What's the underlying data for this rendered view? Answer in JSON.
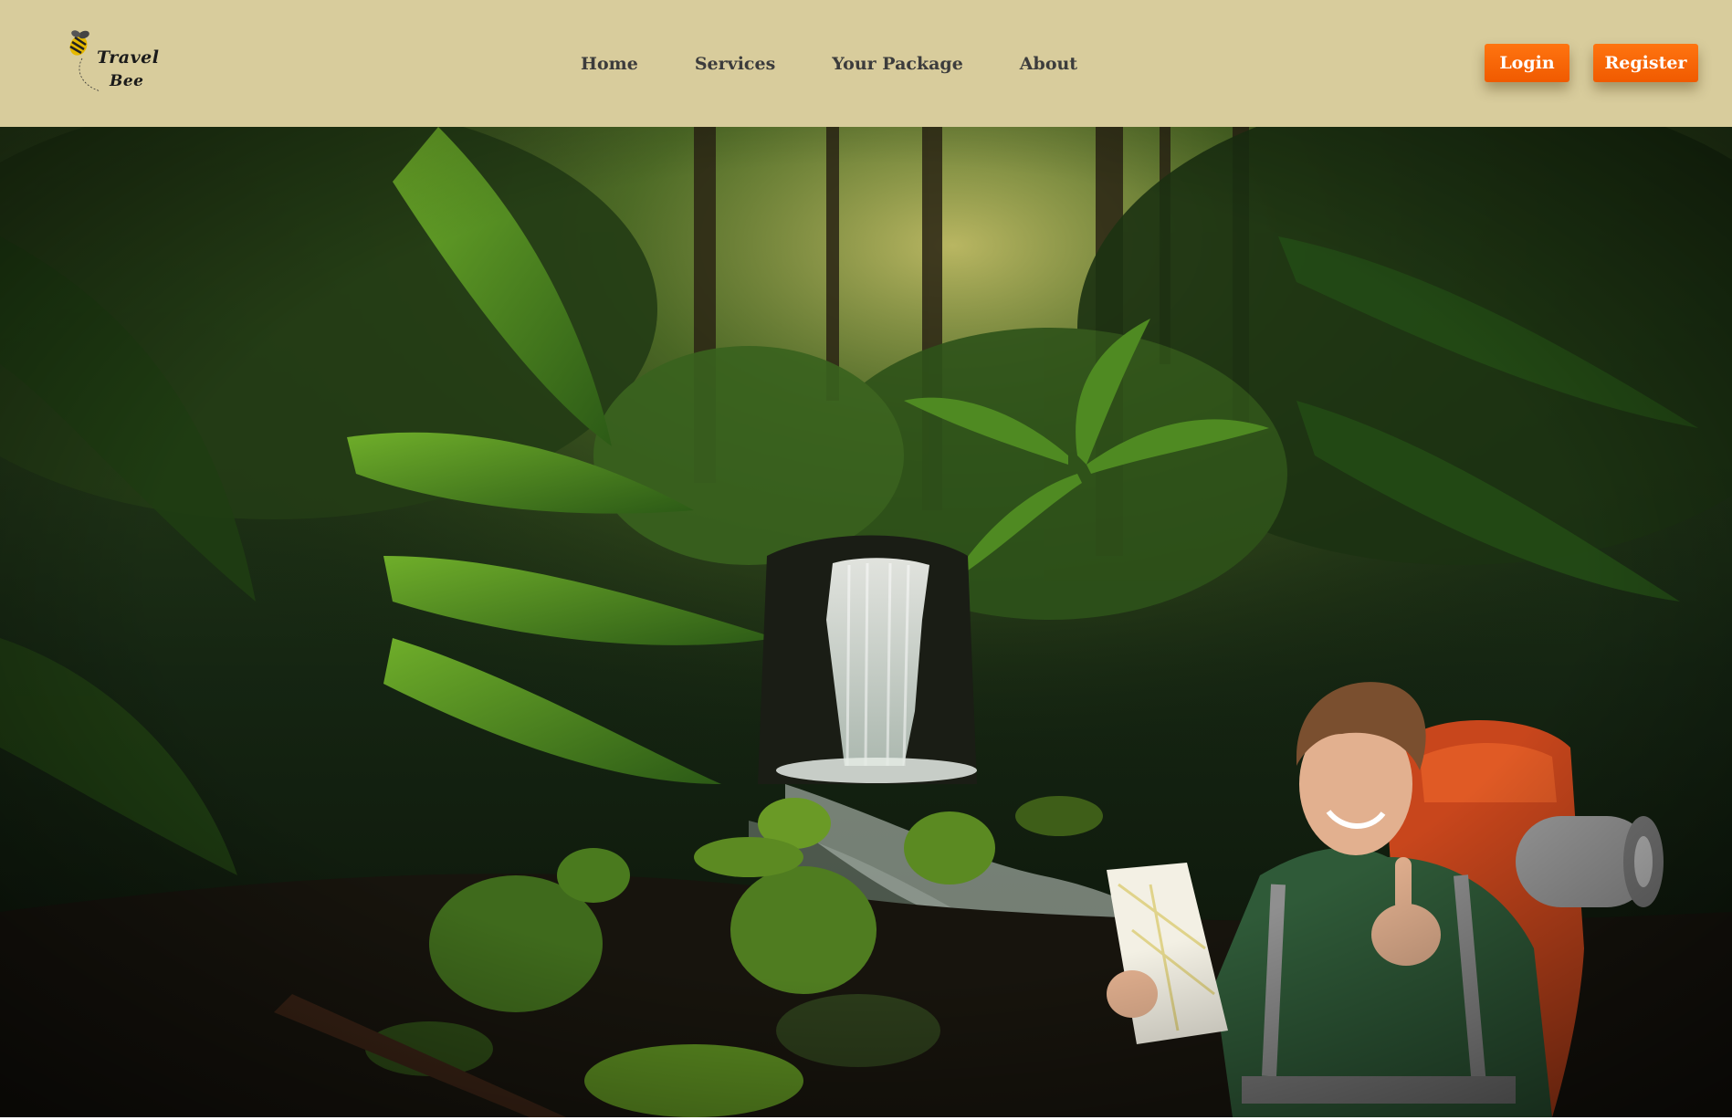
{
  "brand": {
    "line1": "Travel",
    "line2": "Bee",
    "icon": "bee-icon",
    "accent": "#e5b800"
  },
  "nav": {
    "items": [
      {
        "label": "Home"
      },
      {
        "label": "Services"
      },
      {
        "label": "Your Package"
      },
      {
        "label": "About"
      }
    ]
  },
  "auth": {
    "login_label": "Login",
    "register_label": "Register"
  },
  "colors": {
    "navbar": "#d8cc9c",
    "button": "#ff6a00",
    "nav_text": "#3c3c3c"
  },
  "hero": {
    "image": "rainforest-waterfall-with-backpacker"
  }
}
